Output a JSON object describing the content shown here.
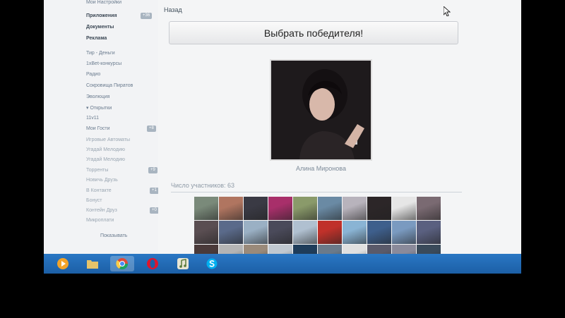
{
  "sidebar": {
    "top_items": [
      {
        "label": "Мои Настройки"
      },
      {
        "label": "Приложения",
        "badge": "+36"
      },
      {
        "label": "Документы"
      },
      {
        "label": "Реклама"
      }
    ],
    "items": [
      {
        "label": "Тир - Деньги"
      },
      {
        "label": "1xBet-конкурсы"
      },
      {
        "label": "Радио"
      },
      {
        "label": "Сокровища Пиратов"
      },
      {
        "label": "Эволюция"
      },
      {
        "label": "▾ Открытки"
      },
      {
        "label": "11v11"
      },
      {
        "label": "Мои Гости",
        "badge": "+8"
      },
      {
        "label": "Игровые Автоматы"
      },
      {
        "label": "Угадай Мелодию"
      },
      {
        "label": "Угадай Мелодию"
      },
      {
        "label": "Торренты",
        "badge": "+9"
      },
      {
        "label": "Новичь Друзь"
      },
      {
        "label": "В Контакте",
        "badge": "+1"
      },
      {
        "label": "Бонуст"
      },
      {
        "label": "Контейн Друз",
        "badge": "+0"
      },
      {
        "label": "Микроплати"
      }
    ],
    "footer": "Показывать"
  },
  "main": {
    "back_label": "Назад",
    "pick_winner_label": "Выбрать победителя!",
    "winner_name": "Алина Миронова",
    "participants_label": "Число участников: 63"
  },
  "thumb_colors": [
    "#7a8a7a",
    "#b07560",
    "#3a3a44",
    "#a82f6a",
    "#8a9a6a",
    "#6a8aa4",
    "#b8b3bc",
    "#2c2628",
    "#e6e6e6",
    "#7a6a72",
    "#5a4e52",
    "#5a6a8a",
    "#9ab0c4",
    "#4a4a5a",
    "#b0c0d0",
    "#c0312a",
    "#8ab4d4",
    "#3e5f8c",
    "#7a9ac0",
    "#5a6080",
    "#4a3a3a",
    "#b4b4b4",
    "#9a8a7a",
    "#c0c8d0",
    "#1e3c5a",
    "#6a7a8a",
    "#e0e0e0",
    "#5a5a6a",
    "#8a8a9a",
    "#3a4a5a"
  ],
  "colors": {
    "taskbar": "#1c5fa6",
    "button_border": "#c9ccd1"
  },
  "taskbar_icons": [
    "media-player-icon",
    "folder-icon",
    "chrome-icon",
    "opera-icon",
    "music-icon",
    "skype-icon"
  ]
}
